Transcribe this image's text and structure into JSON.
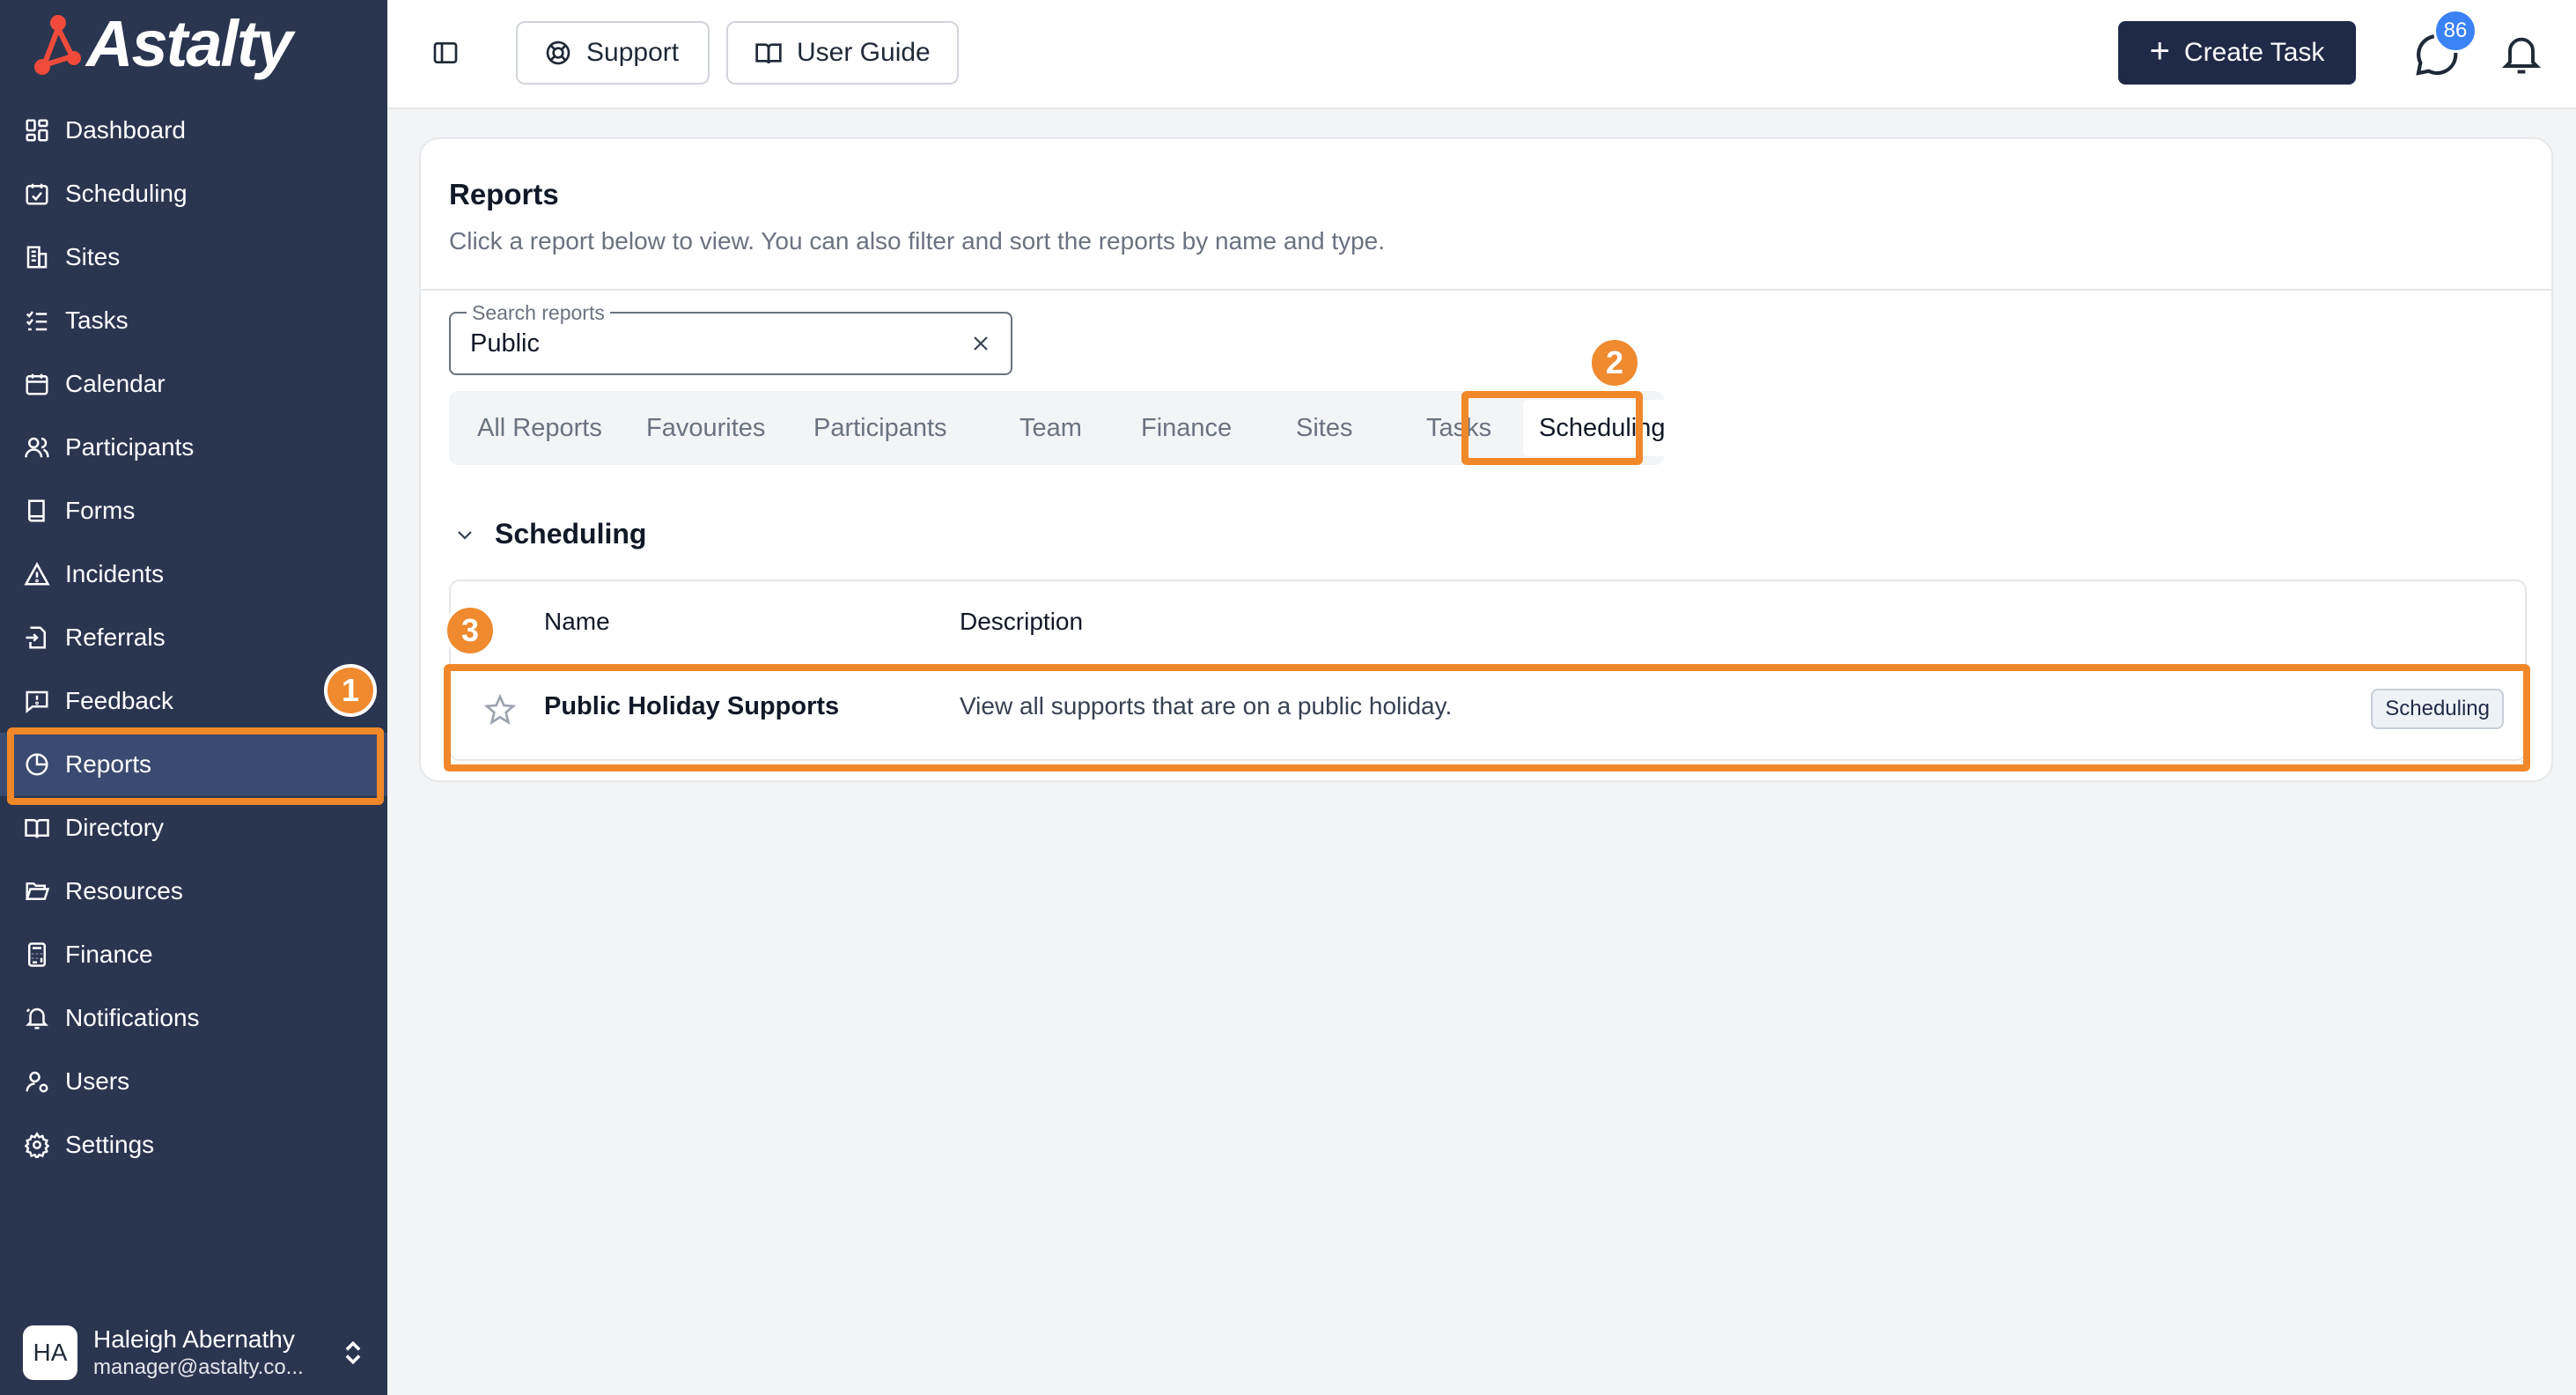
{
  "app": {
    "brand": "Astalty",
    "colors": {
      "sidebar": "#2a3550",
      "accent": "#f0882a",
      "primary_button": "#1f2a48",
      "badge": "#3b82f6"
    }
  },
  "sidebar": {
    "items": [
      {
        "label": "Dashboard",
        "icon": "dashboard-icon"
      },
      {
        "label": "Scheduling",
        "icon": "calendar-check-icon"
      },
      {
        "label": "Sites",
        "icon": "building-icon"
      },
      {
        "label": "Tasks",
        "icon": "list-check-icon"
      },
      {
        "label": "Calendar",
        "icon": "calendar-icon"
      },
      {
        "label": "Participants",
        "icon": "users-icon"
      },
      {
        "label": "Forms",
        "icon": "book-icon"
      },
      {
        "label": "Incidents",
        "icon": "warning-icon"
      },
      {
        "label": "Referrals",
        "icon": "file-import-icon"
      },
      {
        "label": "Feedback",
        "icon": "message-alert-icon"
      },
      {
        "label": "Reports",
        "icon": "pie-chart-icon",
        "active": true
      },
      {
        "label": "Directory",
        "icon": "open-book-icon"
      },
      {
        "label": "Resources",
        "icon": "folder-open-icon"
      },
      {
        "label": "Finance",
        "icon": "calculator-icon"
      },
      {
        "label": "Notifications",
        "icon": "bell-ring-icon"
      },
      {
        "label": "Users",
        "icon": "user-cog-icon"
      },
      {
        "label": "Settings",
        "icon": "gear-icon"
      }
    ],
    "user": {
      "initials": "HA",
      "name": "Haleigh Abernathy",
      "email": "manager@astalty.co..."
    }
  },
  "topbar": {
    "support_label": "Support",
    "guide_label": "User Guide",
    "create_label": "Create Task",
    "chat_badge": "86"
  },
  "reports": {
    "title": "Reports",
    "description": "Click a report below to view. You can also filter and sort the reports by name and type.",
    "search": {
      "label": "Search reports",
      "value": "Public"
    },
    "tabs": [
      "All Reports",
      "Favourites",
      "Participants",
      "Team",
      "Finance",
      "Sites",
      "Tasks",
      "Scheduling"
    ],
    "active_tab": "Scheduling",
    "section": "Scheduling",
    "columns": {
      "name": "Name",
      "description": "Description"
    },
    "rows": [
      {
        "name": "Public Holiday Supports",
        "description": "View all supports that are on a public holiday.",
        "tag": "Scheduling",
        "favourite": false
      }
    ]
  },
  "annotations": {
    "step1": "1",
    "step2": "2",
    "step3": "3"
  }
}
